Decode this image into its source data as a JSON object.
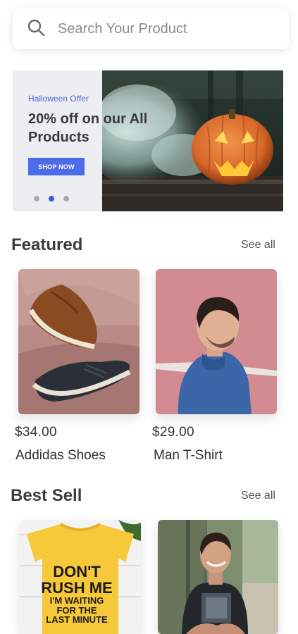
{
  "search": {
    "placeholder": "Search Your Product",
    "icon": "search-icon"
  },
  "banner": {
    "offer_label": "Halloween Offer",
    "headline": "20% off on our All Products",
    "cta_label": "SHOP NOW",
    "slides": 3,
    "active_slide": 2,
    "accent_color": "#4e6bea"
  },
  "featured": {
    "title": "Featured",
    "see_all": "See all",
    "items": [
      {
        "price": "$34.00",
        "name": "Addidas Shoes"
      },
      {
        "price": "$29.00",
        "name": "Man T-Shirt"
      }
    ]
  },
  "best_sell": {
    "title": "Best Sell",
    "see_all": "See all",
    "items": [
      {
        "shirt_text": [
          "DON'T",
          "RUSH ME",
          "I'M WAITING",
          "FOR THE",
          "LAST MINUTE"
        ]
      },
      {
        "shirt_text": []
      }
    ]
  }
}
